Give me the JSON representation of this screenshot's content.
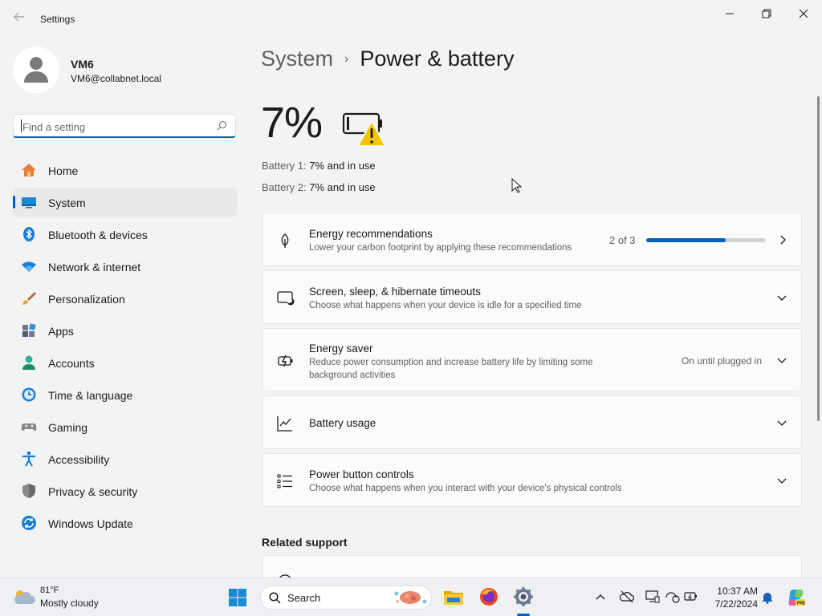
{
  "window": {
    "title": "Settings"
  },
  "profile": {
    "name": "VM6",
    "email": "VM6@collabnet.local"
  },
  "search": {
    "placeholder": "Find a setting"
  },
  "nav": {
    "items": [
      {
        "label": "Home",
        "icon": "home-icon"
      },
      {
        "label": "System",
        "icon": "system-icon",
        "active": true
      },
      {
        "label": "Bluetooth & devices",
        "icon": "bluetooth-icon"
      },
      {
        "label": "Network & internet",
        "icon": "wifi-icon"
      },
      {
        "label": "Personalization",
        "icon": "brush-icon"
      },
      {
        "label": "Apps",
        "icon": "apps-icon"
      },
      {
        "label": "Accounts",
        "icon": "accounts-icon"
      },
      {
        "label": "Time & language",
        "icon": "clock-globe-icon"
      },
      {
        "label": "Gaming",
        "icon": "gamepad-icon"
      },
      {
        "label": "Accessibility",
        "icon": "accessibility-icon"
      },
      {
        "label": "Privacy & security",
        "icon": "shield-icon"
      },
      {
        "label": "Windows Update",
        "icon": "update-icon"
      }
    ]
  },
  "breadcrumb": {
    "parent": "System",
    "separator": "›",
    "current": "Power & battery"
  },
  "battery": {
    "percent": "7%",
    "icon": "battery-warning-icon",
    "lines": [
      {
        "label": "Battery 1:",
        "value": "7% and in use"
      },
      {
        "label": "Battery 2:",
        "value": "7% and in use"
      }
    ]
  },
  "cards": {
    "energy_recommendations": {
      "title": "Energy recommendations",
      "subtitle": "Lower your carbon footprint by applying these recommendations",
      "progress_text": "2 of 3",
      "progress_fraction": 0.667,
      "icon": "leaf-icon"
    },
    "screen_sleep": {
      "title": "Screen, sleep, & hibernate timeouts",
      "subtitle": "Choose what happens when your device is idle for a specified time",
      "icon": "screen-sleep-icon"
    },
    "energy_saver": {
      "title": "Energy saver",
      "subtitle_line1": "Reduce power consumption and increase battery life by limiting some",
      "subtitle_line2": "background activities",
      "value": "On until plugged in",
      "icon": "energy-saver-icon"
    },
    "battery_usage": {
      "title": "Battery usage",
      "icon": "chart-icon"
    },
    "power_button": {
      "title": "Power button controls",
      "subtitle": "Choose what happens when you interact with your device's physical controls",
      "icon": "list-icon"
    }
  },
  "related": {
    "heading": "Related support"
  },
  "taskbar": {
    "weather": {
      "temp": "81°F",
      "desc": "Mostly cloudy"
    },
    "search_label": "Search",
    "clock": {
      "time": "10:37 AM",
      "date": "7/22/2024"
    }
  },
  "colors": {
    "accent": "#005fb8",
    "warning": "#f5c400"
  }
}
